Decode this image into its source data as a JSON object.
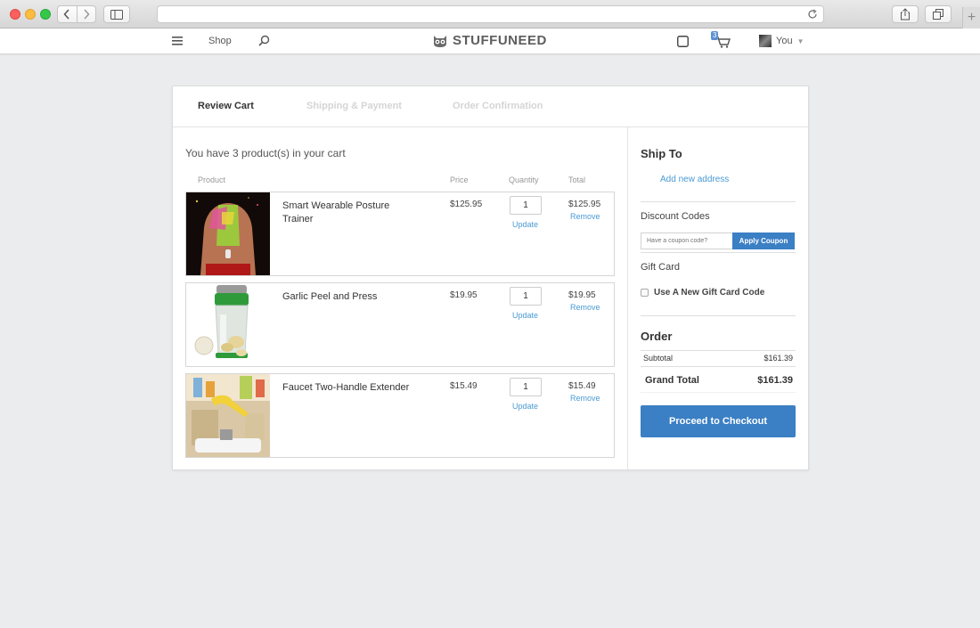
{
  "site": {
    "nav": {
      "shop_label": "Shop",
      "logo_text": "STUFFUNEED",
      "cart_count": "3",
      "user_label": "You"
    }
  },
  "checkout_steps": [
    {
      "label": "Review Cart",
      "state": "active"
    },
    {
      "label": "Shipping & Payment",
      "state": "inactive"
    },
    {
      "label": "Order Confirmation",
      "state": "inactive"
    }
  ],
  "cart": {
    "intro": "You have 3 product(s) in your cart",
    "columns": {
      "product": "Product",
      "price": "Price",
      "quantity": "Quantity",
      "total": "Total"
    },
    "items": [
      {
        "name": "Smart Wearable Posture Trainer",
        "price": "$125.95",
        "quantity": "1",
        "update_label": "Update",
        "total": "$125.95",
        "remove_label": "Remove",
        "image": "posture-trainer-photo"
      },
      {
        "name": "Garlic Peel and Press",
        "price": "$19.95",
        "quantity": "1",
        "update_label": "Update",
        "total": "$19.95",
        "remove_label": "Remove",
        "image": "garlic-press-photo"
      },
      {
        "name": "Faucet Two-Handle Extender",
        "price": "$15.49",
        "quantity": "1",
        "update_label": "Update",
        "total": "$15.49",
        "remove_label": "Remove",
        "image": "faucet-extender-photo"
      }
    ]
  },
  "sidebar": {
    "ship_to": {
      "title": "Ship To",
      "add_address_label": "Add new address"
    },
    "discount": {
      "title": "Discount Codes",
      "placeholder": "Have a coupon code?",
      "button_label": "Apply Coupon"
    },
    "gift_card": {
      "title": "Gift Card",
      "checkbox_label": "Use A New Gift Card Code",
      "checked": false
    },
    "order": {
      "title": "Order",
      "subtotal_label": "Subtotal",
      "subtotal_value": "$161.39",
      "grand_total_label": "Grand Total",
      "grand_total_value": "$161.39"
    },
    "checkout_button_label": "Proceed to Checkout"
  },
  "colors": {
    "accent": "#3b7fc4",
    "link": "#4a9ad4",
    "background": "#ebecee"
  }
}
